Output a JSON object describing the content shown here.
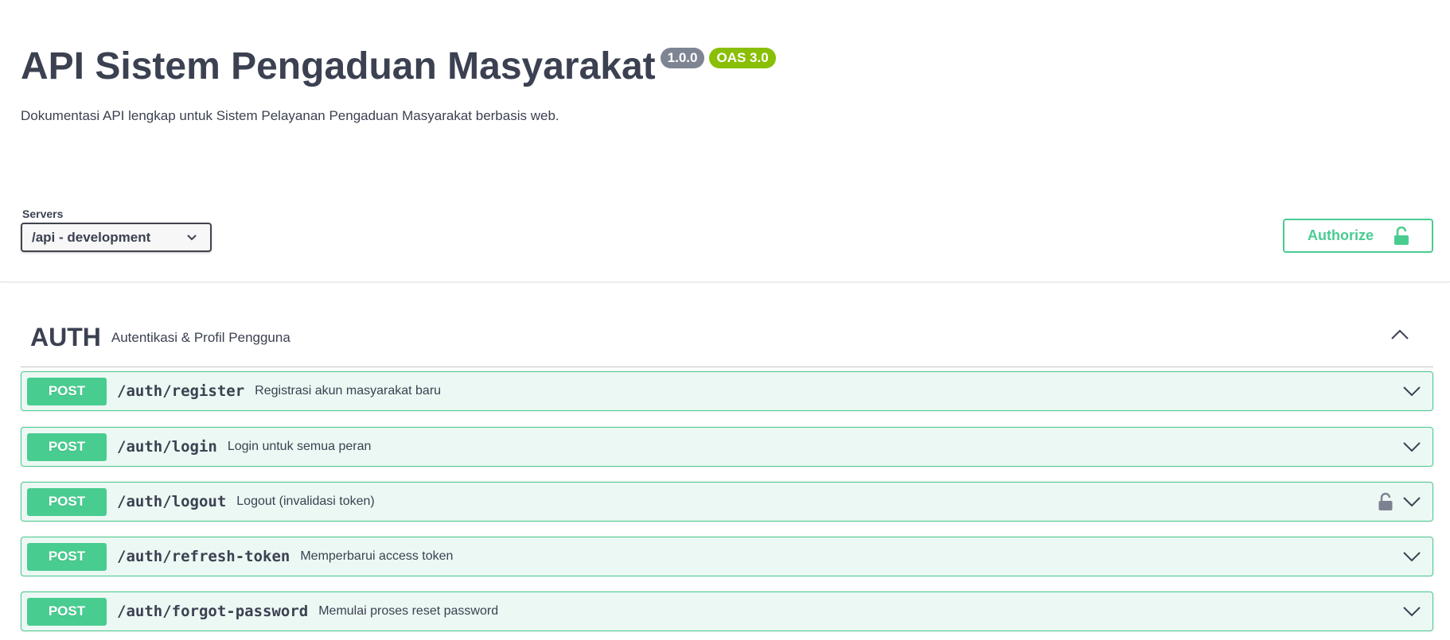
{
  "info": {
    "title": "API Sistem Pengaduan Masyarakat",
    "version": "1.0.0",
    "oas": "OAS 3.0",
    "description": "Dokumentasi API lengkap untuk Sistem Pelayanan Pengaduan Masyarakat berbasis web."
  },
  "servers": {
    "label": "Servers",
    "selected": "/api - development"
  },
  "authorize": {
    "label": "Authorize"
  },
  "tag": {
    "name": "AUTH",
    "description": "Autentikasi & Profil Pengguna"
  },
  "operations": [
    {
      "method": "POST",
      "path": "/auth/register",
      "summary": "Registrasi akun masyarakat baru",
      "locked": false
    },
    {
      "method": "POST",
      "path": "/auth/login",
      "summary": "Login untuk semua peran",
      "locked": false
    },
    {
      "method": "POST",
      "path": "/auth/logout",
      "summary": "Logout (invalidasi token)",
      "locked": true
    },
    {
      "method": "POST",
      "path": "/auth/refresh-token",
      "summary": "Memperbarui access token",
      "locked": false
    },
    {
      "method": "POST",
      "path": "/auth/forgot-password",
      "summary": "Memulai proses reset password",
      "locked": false
    }
  ],
  "colors": {
    "post": "#49cc90",
    "post_bg": "#ecf8f3",
    "text": "#3b4151"
  }
}
